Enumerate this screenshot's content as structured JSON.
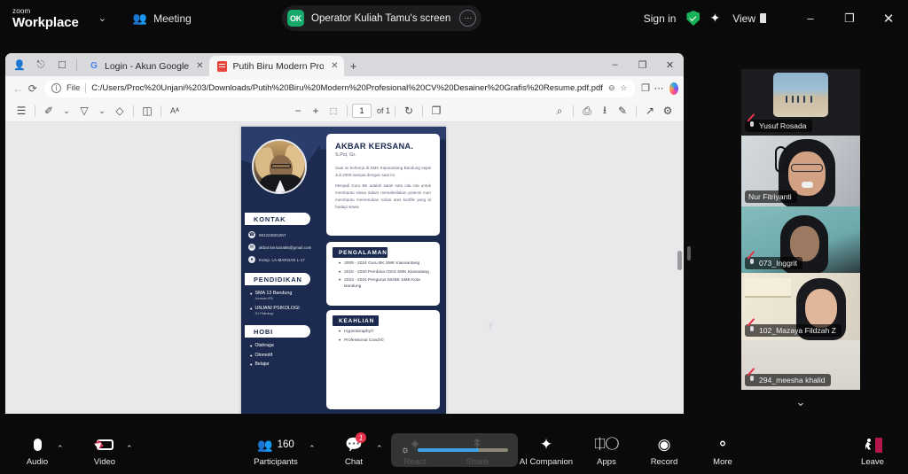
{
  "zoom_topbar": {
    "logo_small": "zoom",
    "logo_main": "Workplace",
    "chevron": "⌄",
    "meeting_label": "Meeting",
    "share_badge": "OK",
    "share_text": "Operator Kuliah Tamu's screen",
    "share_more": "⋯",
    "sign_in": "Sign in",
    "view_label": "View",
    "minimize": "–",
    "maximize": "❐",
    "close": "✕"
  },
  "browser": {
    "tabs": [
      {
        "title": "Login - Akun Google",
        "favicon": "google-icon",
        "active": false,
        "close": "✕"
      },
      {
        "title": "Putih Biru Modern Profesional CV",
        "favicon": "pdf-icon",
        "active": true,
        "close": "✕"
      }
    ],
    "new_tab": "+",
    "window_controls": {
      "minimize": "–",
      "restore": "❐",
      "close": "✕"
    },
    "nav": {
      "back": "←",
      "reload": "⟳"
    },
    "omnibox": {
      "info": "ⓘ",
      "file_label": "File",
      "url": "C:/Users/Proc%20Unjani%203/Downloads/Putih%20Biru%20Modern%20Profesional%20CV%20Desainer%20Grafis%20Resume.pdf.pdf",
      "zoom_icon": "⊖",
      "bookmark_icon": "☆",
      "collections_icon": "❐",
      "settings_icon": "⋯"
    }
  },
  "pdf_toolbar": {
    "toc": "☰",
    "highlight": "✐",
    "chev1": "⌄",
    "draw": "▽",
    "chev2": "⌄",
    "erase": "◇",
    "layout": "◫",
    "read_aloud": "Aᴬ",
    "zoom_out": "−",
    "zoom_in": "+",
    "fit": "⬚",
    "page_value": "1",
    "page_total": "of 1",
    "rotate": "↻",
    "page_view": "❐",
    "search": "⌕",
    "print": "⎙",
    "save": "⭳",
    "edit": "✎",
    "fullscreen": "↗",
    "settings": "⚙"
  },
  "cv": {
    "name": "AKBAR KERSANA.",
    "credential": "S.Psi, Gr.",
    "about_p1": "Saat ini berkerja di SMK Kiansantang Bandung sejak Juli 2009 sampai dengan saat ini.",
    "about_p2": "Menjadi Guru BK adalah salah satu cita cita untuk membantu siswa dalam memaksilakan potensi man membantu menemukan solusi atas konflik yang di hadapi siswa",
    "sections": {
      "kontak": "KONTAK",
      "pendidikan": "PENDIDIKAN",
      "hobi": "HOBI",
      "pengalaman": "PENGALAMAN",
      "keahlian": "KEAHLIAN"
    },
    "contacts": [
      {
        "icon": "phone-icon",
        "text": "081222821057"
      },
      {
        "icon": "mail-icon",
        "text": "akbar.kersana86@gmail.com"
      },
      {
        "icon": "pin-icon",
        "text": "Komp. LA-MARGAS L-17"
      }
    ],
    "education": [
      {
        "title": "SMA 13 Bandung",
        "sub": "Jurusan IPA"
      },
      {
        "title": "UNJANI PSIKOLOGI",
        "sub": "S1 Psikologi"
      }
    ],
    "hobbies": [
      "Olahraga",
      "Otomotif",
      "Belajar"
    ],
    "experience": [
      "2009 - 2024 Guru BK SMK Kiansantang",
      "2015 - 2020 Pembina OSIS SMK Kiansatang",
      "2023 - 2024 Pengurus MGBK SMK Kota Bandung"
    ],
    "skills": [
      "Hypnoteraphy©",
      "Professional Coach©"
    ]
  },
  "participants": [
    {
      "name": "Yusuf Rosada",
      "muted": true,
      "active": false
    },
    {
      "name": "Nur Fitriyanti",
      "muted": false,
      "active": true
    },
    {
      "name": "073_Inggrit",
      "muted": true,
      "active": false
    },
    {
      "name": "102_Mazaya Fildzah Z",
      "muted": true,
      "active": false
    },
    {
      "name": "294_meesha khalid",
      "muted": true,
      "active": false
    }
  ],
  "participants_scroll_down": "⌄",
  "bottom_bar": {
    "audio": {
      "label": "Audio",
      "icon": "microphone-muted-icon",
      "caret": "⌃"
    },
    "video": {
      "label": "Video",
      "icon": "camera-muted-icon",
      "caret": "⌃"
    },
    "participants": {
      "label": "Participants",
      "icon": "people-icon",
      "count": "160",
      "caret": "⌃"
    },
    "chat": {
      "label": "Chat",
      "icon": "chat-bubble-icon",
      "badge": "1",
      "caret": "⌃"
    },
    "react": {
      "label": "React",
      "icon": "sparkle-icon"
    },
    "share": {
      "label": "Share",
      "icon": "share-screen-icon"
    },
    "ai_companion": {
      "label": "AI Companion",
      "icon": "sparkle-icon"
    },
    "apps": {
      "label": "Apps",
      "icon": "apps-icon"
    },
    "record": {
      "label": "Record",
      "icon": "record-icon"
    },
    "more": {
      "label": "More",
      "icon": "ellipsis-icon"
    },
    "leave": {
      "label": "Leave",
      "icon": "leave-door-icon"
    },
    "brightness": {
      "icon": "brightness-icon",
      "value": 68
    }
  },
  "colors": {
    "zoom_bg": "#0a0a0a",
    "cv_navy": "#1b2a4e",
    "accent_green": "#2bd35a",
    "accent_red": "#e8334a",
    "slider_blue": "#3ea0e8"
  }
}
